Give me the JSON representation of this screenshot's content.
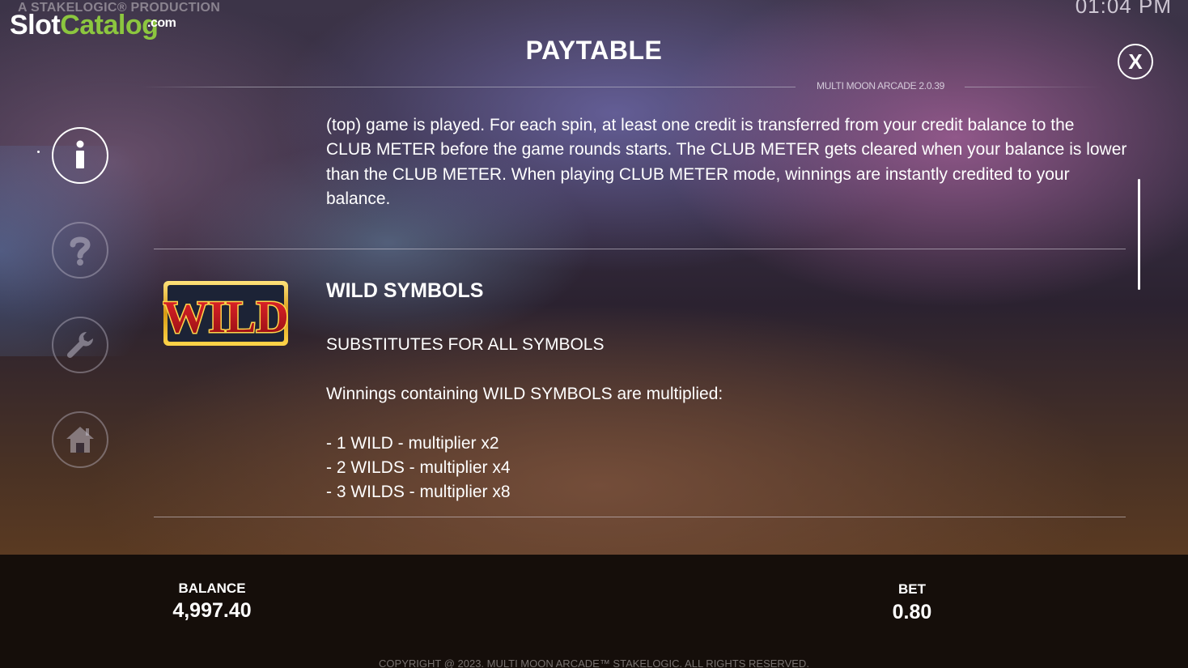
{
  "branding": {
    "tagline": "A STAKELOGIC® PRODUCTION",
    "logo_slot": "Slot",
    "logo_catalog": "Catalog",
    "logo_com": ".com"
  },
  "clock": "01:04 PM",
  "header": {
    "title": "PAYTABLE",
    "version": "MULTI MOON ARCADE 2.0.39",
    "close_label": "X"
  },
  "sidebar": {
    "items": [
      {
        "name": "info",
        "state": "active"
      },
      {
        "name": "help",
        "state": "inactive"
      },
      {
        "name": "settings",
        "state": "inactive"
      },
      {
        "name": "home",
        "state": "inactive"
      }
    ]
  },
  "club_meter_paragraph": {
    "lines": [
      "(top) game is played. For each spin, at least one credit is transferred from your credit balance to the",
      "CLUB METER before the game rounds starts. The CLUB METER gets cleared when your balance is lower",
      "than the CLUB METER. When playing CLUB METER mode, winnings are instantly credited to your",
      "balance."
    ]
  },
  "wild_section": {
    "badge_text": "WILD",
    "title": "WILD SYMBOLS",
    "subtitle": "SUBSTITUTES FOR ALL SYMBOLS",
    "intro": "Winnings containing WILD SYMBOLS are multiplied:",
    "multipliers": [
      "- 1 WILD - multiplier x2",
      "- 2 WILDS - multiplier x4",
      "- 3 WILDS - multiplier x8"
    ]
  },
  "footer": {
    "balance_label": "BALANCE",
    "balance_value": "4,997.40",
    "bet_label": "BET",
    "bet_value": "0.80",
    "copyright": "COPYRIGHT @ 2023. MULTI MOON ARCADE™ STAKELOGIC. ALL RIGHTS RESERVED."
  },
  "colors": {
    "logo_green": "#8cc63f",
    "bottom_bar": "#150e0a",
    "wild_red": "#c8161d",
    "wild_gold": "#f5c400"
  }
}
